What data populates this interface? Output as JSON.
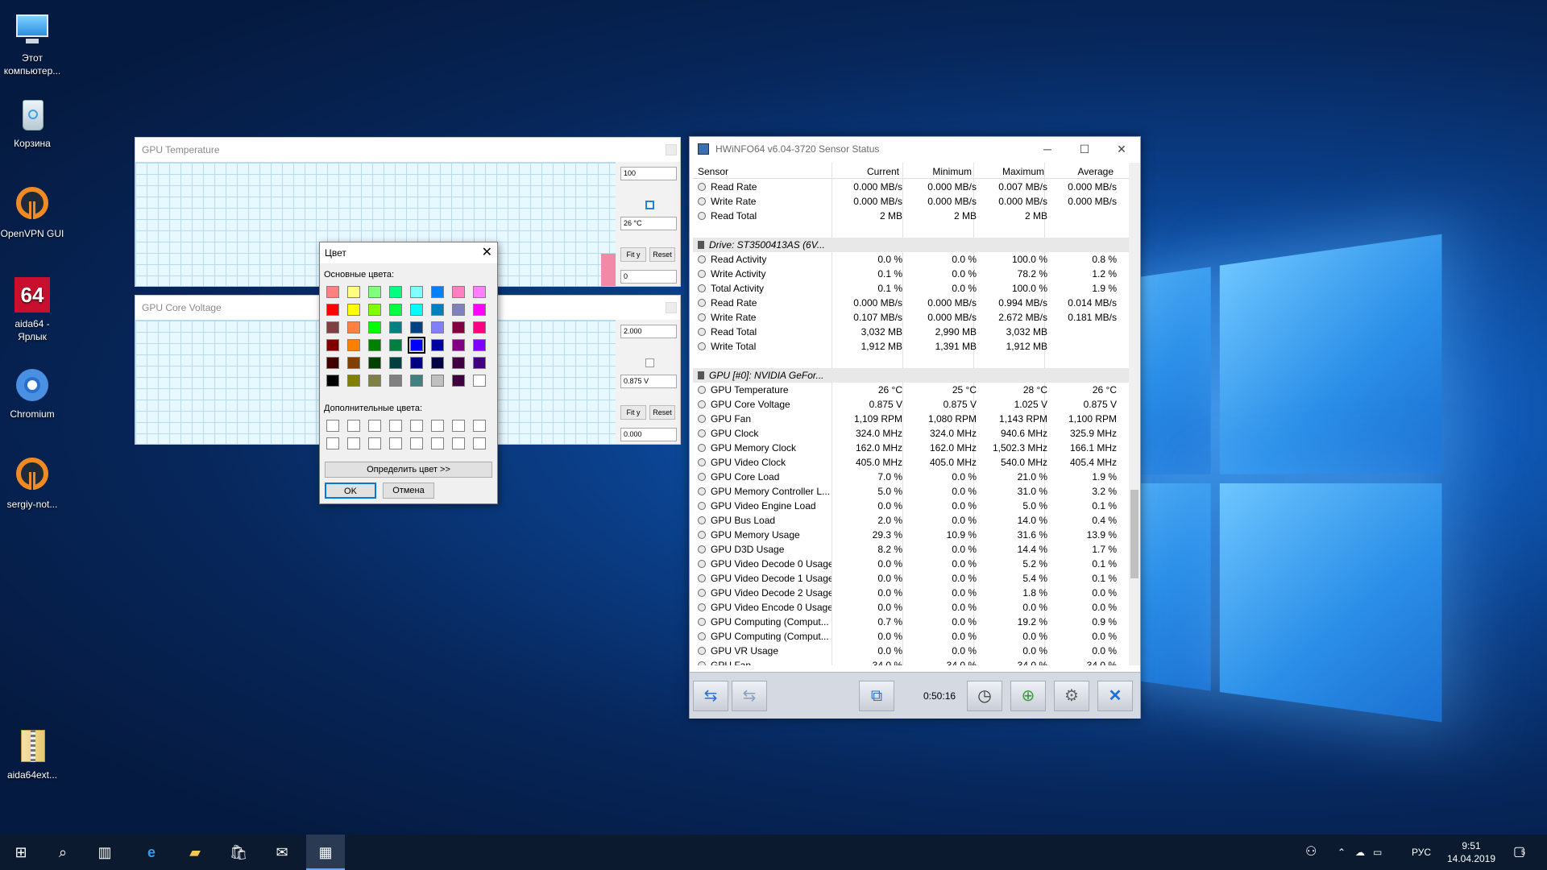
{
  "desktop": {
    "icons": [
      {
        "label": "Этот компьютер...",
        "icon": "computer-icon"
      },
      {
        "label": "Корзина",
        "icon": "recycle-bin-icon"
      },
      {
        "label": "OpenVPN GUI",
        "icon": "openvpn-icon"
      },
      {
        "label": "aida64 - Ярлык",
        "icon": "aida64-icon"
      },
      {
        "label": "Chromium",
        "icon": "chromium-icon"
      },
      {
        "label": "sergiy-not...",
        "icon": "openvpn-icon"
      },
      {
        "label": "aida64ext...",
        "icon": "archive-icon"
      }
    ]
  },
  "graph_temp": {
    "title": "GPU Temperature",
    "max": "100",
    "current": "26 °C",
    "min": "0",
    "fit_label": "Fit y",
    "reset_label": "Reset"
  },
  "graph_voltage": {
    "title": "GPU Core Voltage",
    "max": "2.000",
    "current": "0.875 V",
    "min": "0.000",
    "fit_label": "Fit y",
    "reset_label": "Reset"
  },
  "color_dialog": {
    "title": "Цвет",
    "basic_label": "Основные цвета:",
    "custom_label": "Дополнительные цвета:",
    "define_label": "Определить цвет >>",
    "ok_label": "OK",
    "cancel_label": "Отмена",
    "swatches": [
      "#ff8080",
      "#ffff80",
      "#80ff80",
      "#00ff80",
      "#80ffff",
      "#0080ff",
      "#ff80c0",
      "#ff80ff",
      "#ff0000",
      "#ffff00",
      "#80ff00",
      "#00ff40",
      "#00ffff",
      "#0080c0",
      "#8080c0",
      "#ff00ff",
      "#804040",
      "#ff8040",
      "#00ff00",
      "#008080",
      "#004080",
      "#8080ff",
      "#800040",
      "#ff0080",
      "#800000",
      "#ff8000",
      "#008000",
      "#008040",
      "#0000ff",
      "#0000a0",
      "#800080",
      "#8000ff",
      "#400000",
      "#804000",
      "#004000",
      "#004040",
      "#000080",
      "#000040",
      "#400040",
      "#400080",
      "#000000",
      "#808000",
      "#808040",
      "#808080",
      "#408080",
      "#c0c0c0",
      "#400040",
      "#ffffff"
    ],
    "selected_index": 28
  },
  "hwinfo": {
    "title": "HWiNFO64 v6.04-3720 Sensor Status",
    "columns": [
      "Sensor",
      "Current",
      "Minimum",
      "Maximum",
      "Average"
    ],
    "rows": [
      {
        "name": "Read Rate",
        "cur": "0.000 MB/s",
        "min": "0.000 MB/s",
        "max": "0.007 MB/s",
        "avg": "0.000 MB/s"
      },
      {
        "name": "Write Rate",
        "cur": "0.000 MB/s",
        "min": "0.000 MB/s",
        "max": "0.000 MB/s",
        "avg": "0.000 MB/s"
      },
      {
        "name": "Read Total",
        "cur": "2 MB",
        "min": "2 MB",
        "max": "2 MB",
        "avg": ""
      },
      {
        "blank": true
      },
      {
        "group": true,
        "name": "Drive: ST3500413AS (6V..."
      },
      {
        "name": "Read Activity",
        "cur": "0.0 %",
        "min": "0.0 %",
        "max": "100.0 %",
        "avg": "0.8 %"
      },
      {
        "name": "Write Activity",
        "cur": "0.1 %",
        "min": "0.0 %",
        "max": "78.2 %",
        "avg": "1.2 %"
      },
      {
        "name": "Total Activity",
        "cur": "0.1 %",
        "min": "0.0 %",
        "max": "100.0 %",
        "avg": "1.9 %"
      },
      {
        "name": "Read Rate",
        "cur": "0.000 MB/s",
        "min": "0.000 MB/s",
        "max": "0.994 MB/s",
        "avg": "0.014 MB/s"
      },
      {
        "name": "Write Rate",
        "cur": "0.107 MB/s",
        "min": "0.000 MB/s",
        "max": "2.672 MB/s",
        "avg": "0.181 MB/s"
      },
      {
        "name": "Read Total",
        "cur": "3,032 MB",
        "min": "2,990 MB",
        "max": "3,032 MB",
        "avg": ""
      },
      {
        "name": "Write Total",
        "cur": "1,912 MB",
        "min": "1,391 MB",
        "max": "1,912 MB",
        "avg": ""
      },
      {
        "blank": true
      },
      {
        "group": true,
        "name": "GPU [#0]: NVIDIA GeFor..."
      },
      {
        "name": "GPU Temperature",
        "cur": "26 °C",
        "min": "25 °C",
        "max": "28 °C",
        "avg": "26 °C"
      },
      {
        "name": "GPU Core Voltage",
        "cur": "0.875 V",
        "min": "0.875 V",
        "max": "1.025 V",
        "avg": "0.875 V"
      },
      {
        "name": "GPU Fan",
        "cur": "1,109 RPM",
        "min": "1,080 RPM",
        "max": "1,143 RPM",
        "avg": "1,100 RPM"
      },
      {
        "name": "GPU Clock",
        "cur": "324.0 MHz",
        "min": "324.0 MHz",
        "max": "940.6 MHz",
        "avg": "325.9 MHz"
      },
      {
        "name": "GPU Memory Clock",
        "cur": "162.0 MHz",
        "min": "162.0 MHz",
        "max": "1,502.3 MHz",
        "avg": "166.1 MHz"
      },
      {
        "name": "GPU Video Clock",
        "cur": "405.0 MHz",
        "min": "405.0 MHz",
        "max": "540.0 MHz",
        "avg": "405.4 MHz"
      },
      {
        "name": "GPU Core Load",
        "cur": "7.0 %",
        "min": "0.0 %",
        "max": "21.0 %",
        "avg": "1.9 %"
      },
      {
        "name": "GPU Memory Controller L...",
        "cur": "5.0 %",
        "min": "0.0 %",
        "max": "31.0 %",
        "avg": "3.2 %"
      },
      {
        "name": "GPU Video Engine Load",
        "cur": "0.0 %",
        "min": "0.0 %",
        "max": "5.0 %",
        "avg": "0.1 %"
      },
      {
        "name": "GPU Bus Load",
        "cur": "2.0 %",
        "min": "0.0 %",
        "max": "14.0 %",
        "avg": "0.4 %"
      },
      {
        "name": "GPU Memory Usage",
        "cur": "29.3 %",
        "min": "10.9 %",
        "max": "31.6 %",
        "avg": "13.9 %"
      },
      {
        "name": "GPU D3D Usage",
        "cur": "8.2 %",
        "min": "0.0 %",
        "max": "14.4 %",
        "avg": "1.7 %"
      },
      {
        "name": "GPU Video Decode 0 Usage",
        "cur": "0.0 %",
        "min": "0.0 %",
        "max": "5.2 %",
        "avg": "0.1 %"
      },
      {
        "name": "GPU Video Decode 1 Usage",
        "cur": "0.0 %",
        "min": "0.0 %",
        "max": "5.4 %",
        "avg": "0.1 %"
      },
      {
        "name": "GPU Video Decode 2 Usage",
        "cur": "0.0 %",
        "min": "0.0 %",
        "max": "1.8 %",
        "avg": "0.0 %"
      },
      {
        "name": "GPU Video Encode 0 Usage",
        "cur": "0.0 %",
        "min": "0.0 %",
        "max": "0.0 %",
        "avg": "0.0 %"
      },
      {
        "name": "GPU Computing (Comput...",
        "cur": "0.7 %",
        "min": "0.0 %",
        "max": "19.2 %",
        "avg": "0.9 %"
      },
      {
        "name": "GPU Computing (Comput...",
        "cur": "0.0 %",
        "min": "0.0 %",
        "max": "0.0 %",
        "avg": "0.0 %"
      },
      {
        "name": "GPU VR Usage",
        "cur": "0.0 %",
        "min": "0.0 %",
        "max": "0.0 %",
        "avg": "0.0 %"
      },
      {
        "name": "GPU Fan",
        "cur": "34.0 %",
        "min": "34.0 %",
        "max": "34.0 %",
        "avg": "34.0 %"
      }
    ],
    "elapsed": "0:50:16"
  },
  "taskbar": {
    "lang": "РУС",
    "time": "9:51",
    "date": "14.04.2019",
    "notif_count": "5"
  }
}
